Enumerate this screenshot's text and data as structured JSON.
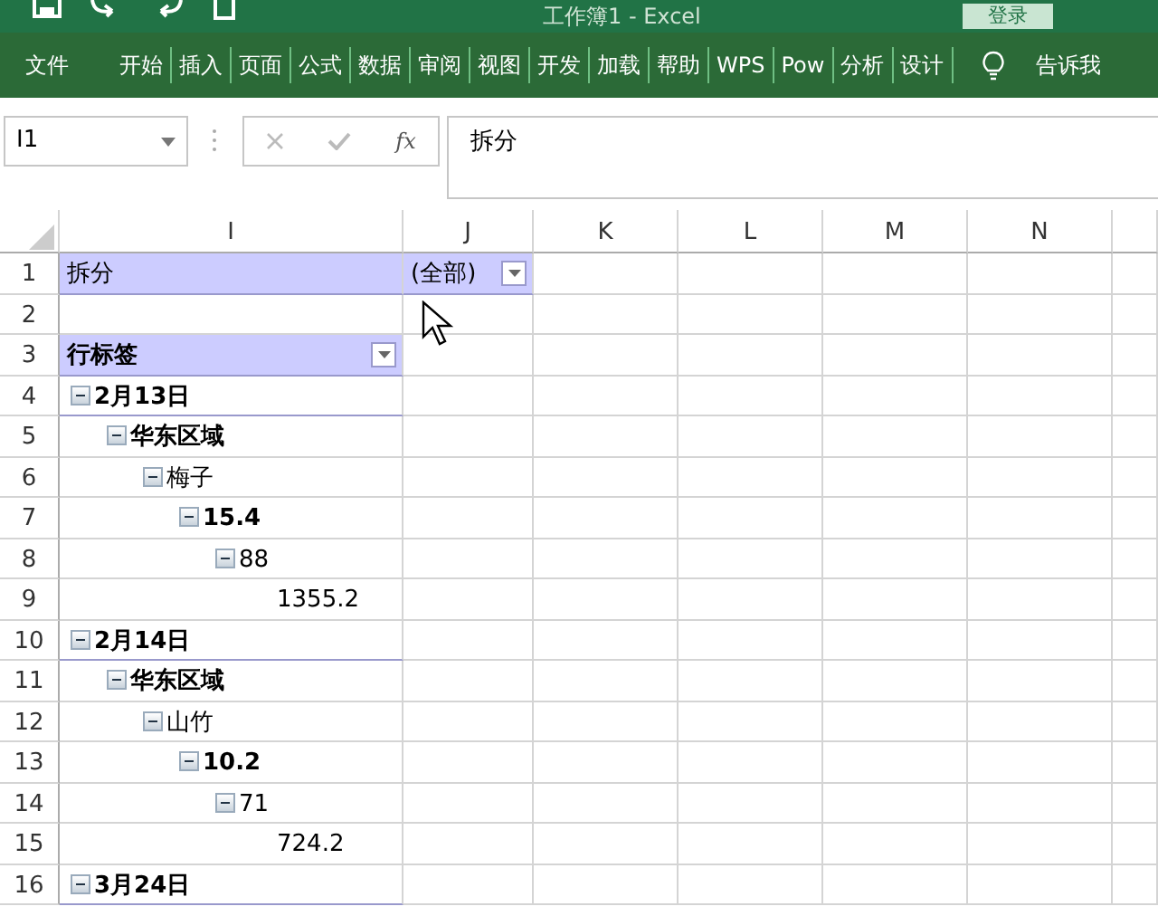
{
  "window": {
    "title": "工作簿1 - Excel",
    "sign_in": "登录"
  },
  "ribbon_tabs": [
    {
      "label": "文件",
      "selected": false
    },
    {
      "label": "开始",
      "selected": false
    },
    {
      "label": "插入",
      "selected": false
    },
    {
      "label": "页面",
      "selected": false
    },
    {
      "label": "公式",
      "selected": false
    },
    {
      "label": "数据",
      "selected": false
    },
    {
      "label": "审阅",
      "selected": false
    },
    {
      "label": "视图",
      "selected": false
    },
    {
      "label": "开发",
      "selected": false
    },
    {
      "label": "加载",
      "selected": false
    },
    {
      "label": "帮助",
      "selected": false
    },
    {
      "label": "WPS",
      "selected": false
    },
    {
      "label": "Pow",
      "selected": false
    },
    {
      "label": "分析",
      "selected": false
    },
    {
      "label": "设计",
      "selected": false
    }
  ],
  "tell_me": "告诉我",
  "formula_bar": {
    "name_box": "I1",
    "function_label": "fx",
    "content": "拆分"
  },
  "columns": [
    "I",
    "J",
    "K",
    "L",
    "M",
    "N"
  ],
  "row_numbers": [
    "1",
    "2",
    "3",
    "4",
    "5",
    "6",
    "7",
    "8",
    "9",
    "10",
    "11",
    "12",
    "13",
    "14",
    "15",
    "16"
  ],
  "pivot": {
    "filter_label": "拆分",
    "filter_value": "(全部)",
    "row_header": "行标签",
    "rows": [
      {
        "label": "2月13日",
        "expanded": true,
        "children": [
          {
            "label": "华东区域",
            "expanded": true,
            "children": [
              {
                "label": "梅子",
                "expanded": true,
                "children": [
                  {
                    "label": "15.4",
                    "expanded": true,
                    "children": [
                      {
                        "label": "88",
                        "expanded": true,
                        "children": [
                          {
                            "label": "1355.2"
                          }
                        ]
                      }
                    ]
                  }
                ]
              }
            ]
          }
        ]
      },
      {
        "label": "2月14日",
        "expanded": true,
        "children": [
          {
            "label": "华东区域",
            "expanded": true,
            "children": [
              {
                "label": "山竹",
                "expanded": true,
                "children": [
                  {
                    "label": "10.2",
                    "expanded": true,
                    "children": [
                      {
                        "label": "71",
                        "expanded": true,
                        "children": [
                          {
                            "label": "724.2"
                          }
                        ]
                      }
                    ]
                  }
                ]
              }
            ]
          }
        ]
      },
      {
        "label": "3月24日",
        "expanded": true
      }
    ]
  }
}
